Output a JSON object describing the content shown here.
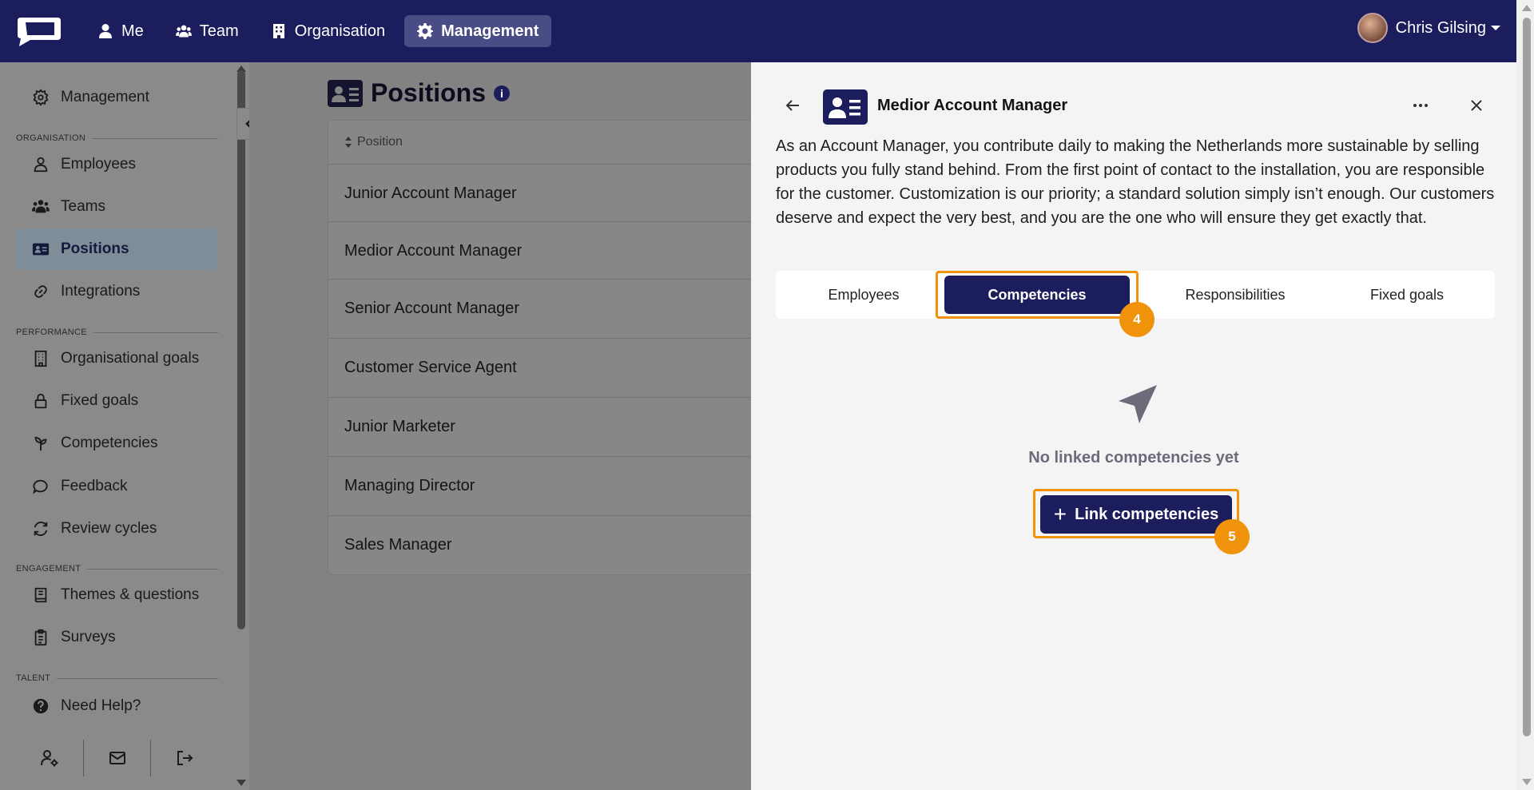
{
  "topbar": {
    "nav": [
      {
        "label": "Me",
        "icon": "user-icon"
      },
      {
        "label": "Team",
        "icon": "users-icon"
      },
      {
        "label": "Organisation",
        "icon": "building-icon"
      },
      {
        "label": "Management",
        "icon": "gear-icon",
        "active": true
      }
    ],
    "user_name": "Chris Gilsing"
  },
  "sidebar": {
    "management": "Management",
    "sections": {
      "organisation": "ORGANISATION",
      "performance": "PERFORMANCE",
      "engagement": "ENGAGEMENT",
      "talent": "TALENT"
    },
    "items": {
      "employees": "Employees",
      "teams": "Teams",
      "positions": "Positions",
      "integrations": "Integrations",
      "organisational_goals": "Organisational goals",
      "fixed_goals": "Fixed goals",
      "competencies": "Competencies",
      "feedback": "Feedback",
      "review_cycles": "Review cycles",
      "themes_questions": "Themes & questions",
      "surveys": "Surveys",
      "need_help": "Need Help?"
    }
  },
  "main": {
    "title": "Positions",
    "column_header": "Position",
    "rows": [
      "Junior Account Manager",
      "Medior Account Manager",
      "Senior Account Manager",
      "Customer Service Agent",
      "Junior Marketer",
      "Managing Director",
      "Sales Manager"
    ]
  },
  "panel": {
    "title": "Medior Account Manager",
    "description": "As an Account Manager, you contribute daily to making the Netherlands more sustainable by selling products you fully stand behind. From the first point of contact to the installation, you are responsible for the customer. Customization is our priority; a standard solution simply isn’t enough. Our customers deserve and expect the very best, and you are the one who will ensure they get exactly that.",
    "tabs": [
      "Employees",
      "Competencies",
      "Responsibilities",
      "Fixed goals"
    ],
    "active_tab": "Competencies",
    "empty_text": "No linked competencies yet",
    "link_button": "Link competencies",
    "step_badges": [
      "4",
      "5"
    ]
  },
  "colors": {
    "brand": "#1c1d5c",
    "highlight": "#f0920a"
  }
}
